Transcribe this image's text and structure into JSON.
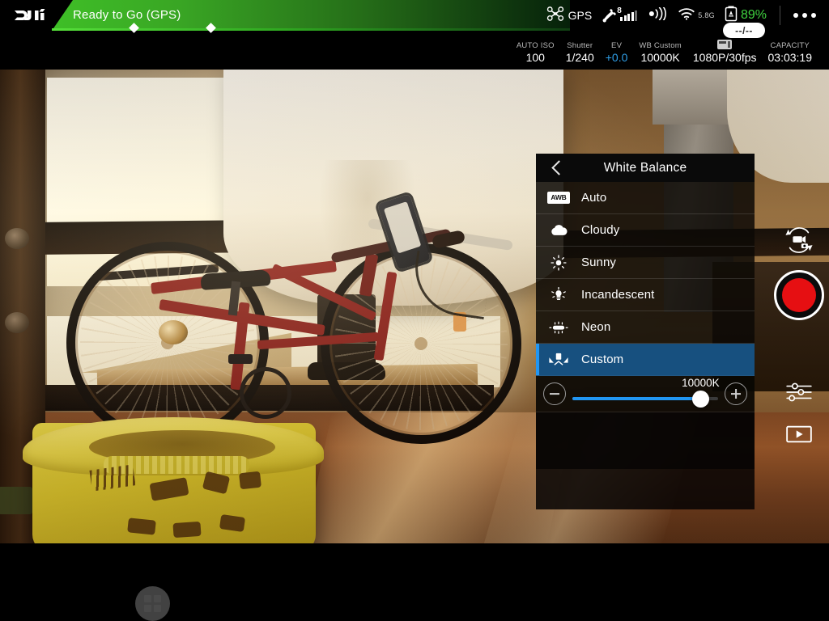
{
  "topbar": {
    "logo": "dji-logo",
    "status_text": "Ready to Go (GPS)",
    "gps_label": "GPS",
    "satellite_count": "8",
    "wifi_band": "5.8G",
    "battery_percent": "89%",
    "altitude_pill": "--/--",
    "menu_icon": "more-options-icon"
  },
  "camera_params": {
    "iso_label": "AUTO ISO",
    "iso_value": "100",
    "shutter_label": "Shutter",
    "shutter_value": "1/240",
    "ev_label": "EV",
    "ev_value": "+0.0",
    "wb_label": "WB Custom",
    "wb_value": "10000K",
    "resolution_value": "1080P/30fps",
    "capacity_label": "CAPACITY",
    "capacity_value": "03:03:19"
  },
  "white_balance_panel": {
    "title": "White Balance",
    "back_icon": "back-chevron-icon",
    "items": [
      {
        "label": "Auto",
        "icon": "awb-badge-icon",
        "badge": "AWB",
        "selected": false
      },
      {
        "label": "Cloudy",
        "icon": "cloud-icon",
        "selected": false
      },
      {
        "label": "Sunny",
        "icon": "sun-icon",
        "selected": false
      },
      {
        "label": "Incandescent",
        "icon": "light-bulb-icon",
        "selected": false
      },
      {
        "label": "Neon",
        "icon": "neon-tube-icon",
        "selected": false
      },
      {
        "label": "Custom",
        "icon": "custom-wb-icon",
        "selected": true
      }
    ],
    "slider": {
      "value_label": "10000K",
      "decrease_icon": "minus-circle-icon",
      "increase_icon": "plus-circle-icon",
      "fill_percent": 88,
      "min_kelvin": 2000,
      "max_kelvin": 10000,
      "current_kelvin": 10000
    }
  },
  "right_controls": {
    "mode_toggle_icon": "photo-video-toggle-icon",
    "record_button_icon": "record-button-icon",
    "settings_icon": "camera-settings-sliders-icon",
    "playback_icon": "playback-icon"
  },
  "bottom_controls": {
    "grid_button_icon": "app-grid-icon"
  },
  "colors": {
    "accent_blue": "#2196f3",
    "selected_row": "#17507f",
    "status_green": "#3fbf27",
    "battery_green": "#3fd23f",
    "record_red": "#e60f12",
    "ev_blue": "#2f9fe8"
  }
}
